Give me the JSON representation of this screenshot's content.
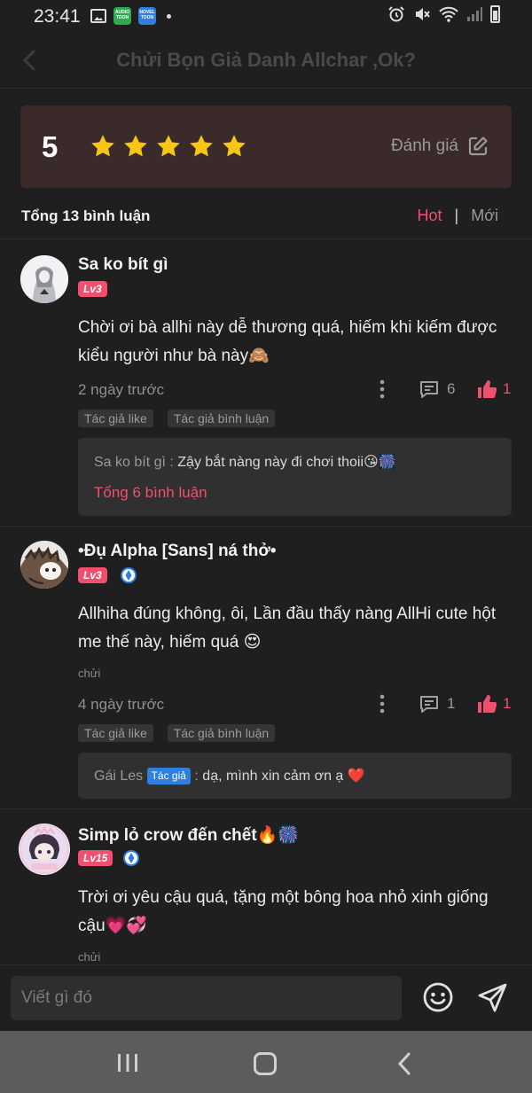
{
  "status_bar": {
    "time": "23:41",
    "app1_label": "AUDIO TOON",
    "app2_label": "NOVEL TOON"
  },
  "header": {
    "title": "Chửi Bọn Giả Danh Allchar ,Ok?"
  },
  "rating": {
    "score": "5",
    "stars": 5,
    "rate_label": "Đánh giá"
  },
  "comments_header": {
    "total_label": "Tổng 13 bình luận",
    "sort_hot": "Hot",
    "sort_sep": "|",
    "sort_new": "Mới"
  },
  "comments": [
    {
      "name": "Sa ko bít gì",
      "level": "Lv3",
      "text": "Chời ơi bà allhi này dễ thương quá, hiếm khi kiếm được kiểu người như bà này🙈",
      "time": "2 ngày trước",
      "reply_count": "6",
      "like_count": "1",
      "tags": [
        "Tác giả like",
        "Tác giả bình luận"
      ],
      "reply_author": "Sa ko bít gì",
      "reply_text": "Zậy bắt nàng này đi chơi thoii😘🎆",
      "reply_total": "Tổng 6 bình luận"
    },
    {
      "name": "•Đụ Alpha [Sans] ná thở•",
      "level": "Lv3",
      "text": "Allhiha đúng không, ôi, Lần đầu thấy nàng AllHi cute hột me thế này, hiếm quá 😍",
      "sub": "chửi",
      "time": "4 ngày trước",
      "reply_count": "1",
      "like_count": "1",
      "tags": [
        "Tác giả like",
        "Tác giả bình luận"
      ],
      "reply_author": "Gái Les",
      "reply_badge": "Tác giả",
      "reply_text": "dạ, mình xin cảm ơn ạ ❤️"
    },
    {
      "name": "Simp lỏ crow đến chết🔥🎆",
      "level": "Lv15",
      "text": "Trời ơi yêu cậu quá, tặng một bông hoa nhỏ xinh giống cậu💗💞",
      "sub": "chửi"
    }
  ],
  "input": {
    "placeholder": "Viết gì đó"
  },
  "colors": {
    "accent": "#f0506e",
    "star": "#f5c518",
    "card_bg": "#3a2a2a",
    "verify": "#2f7fe0"
  }
}
